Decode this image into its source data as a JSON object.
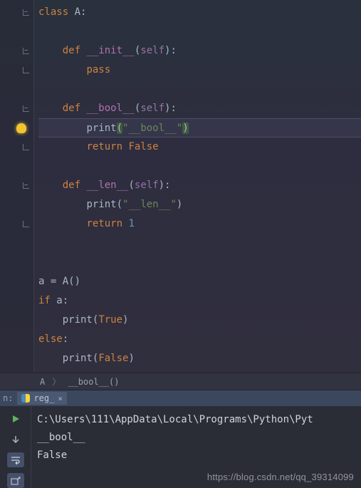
{
  "code": {
    "lines": [
      {
        "indent": 0,
        "kind": "class_def",
        "class_name": "A"
      },
      {
        "indent": 0,
        "kind": "blank"
      },
      {
        "indent": 1,
        "kind": "method_def",
        "name": "__init__",
        "params": "self"
      },
      {
        "indent": 2,
        "kind": "pass"
      },
      {
        "indent": 0,
        "kind": "blank"
      },
      {
        "indent": 1,
        "kind": "method_def",
        "name": "__bool__",
        "params": "self"
      },
      {
        "indent": 2,
        "kind": "print_str",
        "value": "\"__bool__\"",
        "caret": true,
        "match_paren": true
      },
      {
        "indent": 2,
        "kind": "return_const",
        "value": "False"
      },
      {
        "indent": 0,
        "kind": "blank"
      },
      {
        "indent": 1,
        "kind": "method_def",
        "name": "__len__",
        "params": "self"
      },
      {
        "indent": 2,
        "kind": "print_str",
        "value": "\"__len__\""
      },
      {
        "indent": 2,
        "kind": "return_num",
        "value": "1"
      },
      {
        "indent": 0,
        "kind": "blank"
      },
      {
        "indent": 0,
        "kind": "blank"
      },
      {
        "indent": 0,
        "kind": "assign_call",
        "target": "a",
        "call": "A"
      },
      {
        "indent": 0,
        "kind": "if",
        "expr": "a"
      },
      {
        "indent": 1,
        "kind": "print_const",
        "value": "True"
      },
      {
        "indent": 0,
        "kind": "else"
      },
      {
        "indent": 1,
        "kind": "print_const",
        "value": "False"
      }
    ]
  },
  "breadcrumb": {
    "class": "A",
    "method": "__bool__()"
  },
  "run": {
    "label": "n:",
    "tab_name": "reg_",
    "output": [
      "C:\\Users\\111\\AppData\\Local\\Programs\\Python\\Pyt",
      "__bool__",
      "False"
    ]
  },
  "watermark": "https://blog.csdn.net/qq_39314099",
  "tool_buttons": [
    "play-icon",
    "arrow-down-icon",
    "overflow-icon",
    "export-icon"
  ]
}
